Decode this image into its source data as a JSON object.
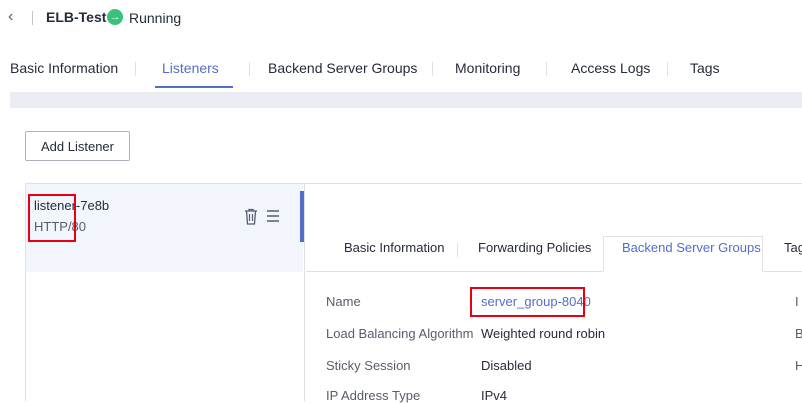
{
  "header": {
    "back_icon": "chevron-left-icon",
    "title": "ELB-Test",
    "status_icon": "arrow-right-circle-icon",
    "status": "Running",
    "status_color": "#3ac27c"
  },
  "tabs": [
    {
      "label": "Basic Information",
      "active": false
    },
    {
      "label": "Listeners",
      "active": true
    },
    {
      "label": "Backend Server Groups",
      "active": false
    },
    {
      "label": "Monitoring",
      "active": false
    },
    {
      "label": "Access Logs",
      "active": false
    },
    {
      "label": "Tags",
      "active": false
    }
  ],
  "add_listener_label": "Add Listener",
  "listener": {
    "name": "listener-7e8b",
    "protocol": "HTTP/80",
    "delete_icon": "trash-icon",
    "menu_icon": "menu-icon"
  },
  "detail_tabs": [
    {
      "label": "Basic Information",
      "active": false
    },
    {
      "label": "Forwarding Policies",
      "active": false
    },
    {
      "label": "Backend Server Groups",
      "active": true
    },
    {
      "label": "Tag",
      "active": false
    }
  ],
  "details": [
    {
      "label": "Name",
      "value": "server_group-8040",
      "link": true,
      "edge": "I"
    },
    {
      "label": "Load Balancing Algorithm",
      "value": "Weighted round robin",
      "link": false,
      "edge": "B"
    },
    {
      "label": "Sticky Session",
      "value": "Disabled",
      "link": false,
      "edge": "H"
    },
    {
      "label": "IP Address Type",
      "value": "IPv4",
      "link": false,
      "edge": ""
    }
  ],
  "colors": {
    "accent": "#526ecc",
    "highlight_border": "#e60012"
  }
}
